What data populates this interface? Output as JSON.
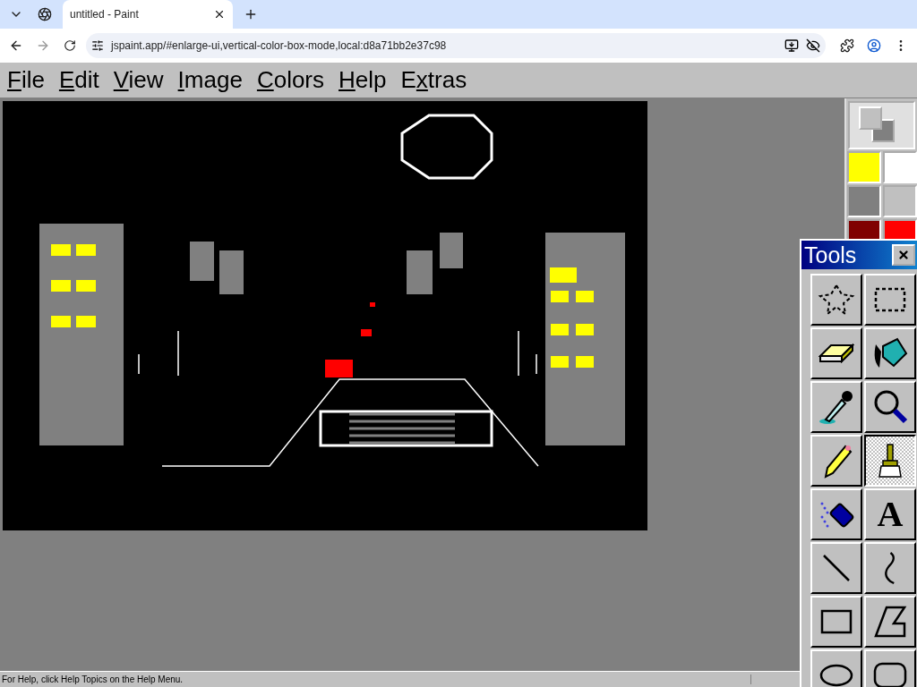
{
  "browser": {
    "tabs": [
      {
        "title": "untitled - Paint",
        "selected": true
      }
    ],
    "address": "jspaint.app/#enlarge-ui,vertical-color-box-mode,local:d8a71bb2e37c98"
  },
  "menu": [
    {
      "key": "F",
      "after": "ile"
    },
    {
      "key": "E",
      "after": "dit"
    },
    {
      "key": "V",
      "after": "iew"
    },
    {
      "key": "I",
      "after": "mage"
    },
    {
      "key": "C",
      "after": "olors"
    },
    {
      "key": "H",
      "after": "elp"
    },
    {
      "before": "E",
      "key": "x",
      "after": "tras"
    }
  ],
  "palette": [
    {
      "color": "#ffff00"
    },
    {
      "color": "#ffffff"
    },
    {
      "color": "#808080"
    },
    {
      "color": "#c0c0c0"
    },
    {
      "color": "#800000"
    },
    {
      "color": "#ff0000"
    }
  ],
  "tools_window": {
    "title": "Tools",
    "tools": [
      {
        "kind": "free-select",
        "selected": false
      },
      {
        "kind": "select",
        "selected": false
      },
      {
        "kind": "eraser",
        "selected": false
      },
      {
        "kind": "fill",
        "selected": false
      },
      {
        "kind": "picker",
        "selected": false
      },
      {
        "kind": "magnifier",
        "selected": false
      },
      {
        "kind": "pencil",
        "selected": false
      },
      {
        "kind": "brush",
        "selected": true
      },
      {
        "kind": "airbrush",
        "selected": false
      },
      {
        "kind": "text",
        "selected": false,
        "glyph": "A"
      },
      {
        "kind": "line",
        "selected": false
      },
      {
        "kind": "curve",
        "selected": false
      },
      {
        "kind": "rectangle",
        "selected": false
      },
      {
        "kind": "polygon",
        "selected": false
      },
      {
        "kind": "ellipse",
        "selected": false
      },
      {
        "kind": "rounded-rectangle",
        "selected": false
      }
    ]
  },
  "status_bar": {
    "text": "For Help, click Help Topics on the Help Menu."
  }
}
